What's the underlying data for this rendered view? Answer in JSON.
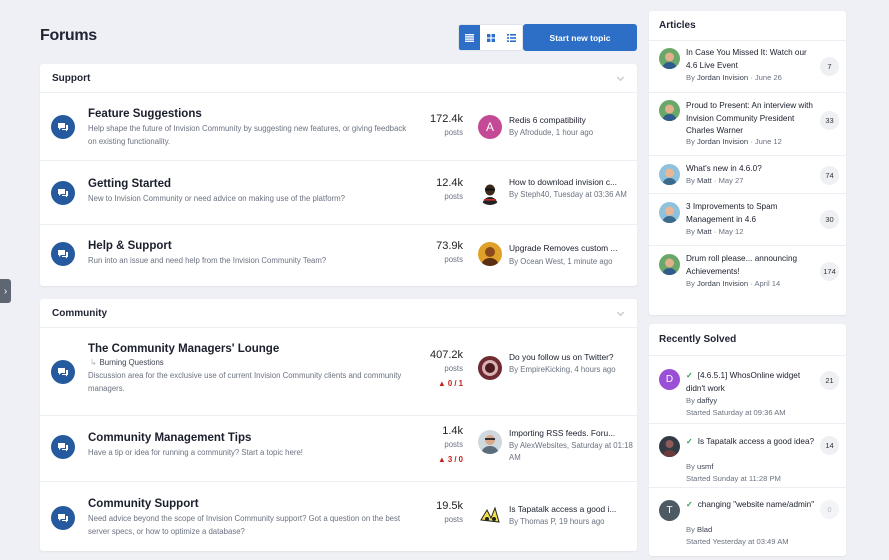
{
  "header": {
    "title": "Forums",
    "start_topic_label": "Start new topic",
    "view_modes": [
      "table-view",
      "grid-view",
      "fluid-view"
    ]
  },
  "colors": {
    "accent": "#2d6fc6",
    "forum_icon": "#255a9e",
    "report": "#c2201b",
    "solved": "#2f9e53"
  },
  "categories": [
    {
      "name": "Support",
      "forums": [
        {
          "title": "Feature Suggestions",
          "description": "Help shape the future of Invision Community by suggesting new features, or giving feedback on existing functionality.",
          "count": "172.4k",
          "count_label": "posts",
          "last_title": "Redis 6 compatibility",
          "last_meta": "By Afrodude, 1 hour ago",
          "avatar_letter": "A",
          "avatar_color": "#c54a95"
        },
        {
          "title": "Getting Started",
          "description": "New to Invision Community or need advice on making use of the platform?",
          "count": "12.4k",
          "count_label": "posts",
          "last_title": "How to download invision c...",
          "last_meta": "By Steph40, Tuesday at 03:36 AM",
          "avatar_letter": "",
          "avatar_color": "#ffffff"
        },
        {
          "title": "Help & Support",
          "description": "Run into an issue and need help from the Invision Community Team?",
          "count": "73.9k",
          "count_label": "posts",
          "last_title": "Upgrade Removes custom ...",
          "last_meta": "By Ocean West, 1 minute ago",
          "avatar_letter": "",
          "avatar_color": "#e0a12a"
        }
      ]
    },
    {
      "name": "Community",
      "forums": [
        {
          "title": "The Community Managers' Lounge",
          "subforum": "Burning Questions",
          "description": "Discussion area for the exclusive use of current Invision Community clients and community managers.",
          "count": "407.2k",
          "count_label": "posts",
          "report": "0 / 1",
          "last_title": "Do you follow us on Twitter?",
          "last_meta": "By EmpireKicking, 4 hours ago",
          "avatar_letter": "",
          "avatar_color": "#b74a58"
        },
        {
          "title": "Community Management Tips",
          "description": "Have a tip or idea for running a community? Start a topic here!",
          "count": "1.4k",
          "count_label": "posts",
          "report": "3 / 0",
          "last_title": "Importing RSS feeds. Foru...",
          "last_meta": "By AlexWebsites, Saturday at 01:18 AM",
          "avatar_letter": "",
          "avatar_color": "#9aa7b4"
        },
        {
          "title": "Community Support",
          "description": "Need advice beyond the scope of Invision Community support? Got a question on the best server specs, or how to optimize a database?",
          "count": "19.5k",
          "count_label": "posts",
          "last_title": "Is Tapatalk access a good i...",
          "last_meta": "By Thomas P, 19 hours ago",
          "avatar_letter": "",
          "avatar_color": "#f2e24a"
        }
      ]
    }
  ],
  "articles": {
    "heading": "Articles",
    "items": [
      {
        "title": "In Case You Missed It: Watch our 4.6 Live Event",
        "author": "Jordan Invision",
        "date": "June 26",
        "count": "7"
      },
      {
        "title": "Proud to Present: An interview with Invision Community President Charles Warner",
        "author": "Jordan Invision",
        "date": "June 12",
        "count": "33"
      },
      {
        "title": "What's new in 4.6.0?",
        "author": "Matt",
        "date": "May 27",
        "count": "74"
      },
      {
        "title": "3 Improvements to Spam Management in 4.6",
        "author": "Matt",
        "date": "May 12",
        "count": "30"
      },
      {
        "title": "Drum roll please... announcing Achievements!",
        "author": "Jordan Invision",
        "date": "April 14",
        "count": "174"
      }
    ]
  },
  "recently_solved": {
    "heading": "Recently Solved",
    "items": [
      {
        "title": "[4.6.5.1] WhosOnline widget didn't work",
        "author": "daffyy",
        "started": "Started Saturday at 09:36 AM",
        "count": "21",
        "avatar_letter": "D",
        "avatar_color": "#9b4fd6"
      },
      {
        "title": "Is Tapatalk access a good idea?",
        "author": "usmf",
        "started": "Started Sunday at 11:28 PM",
        "count": "14",
        "avatar_letter": "",
        "avatar_color": "#333a44"
      },
      {
        "title": "changing \"website name/admin\"",
        "author": "Blad",
        "started": "Started Yesterday at 03:49 AM",
        "count": "0",
        "avatar_letter": "T",
        "avatar_color": "#4d5a63"
      }
    ]
  },
  "labels": {
    "by": "By",
    "sep": "·"
  }
}
